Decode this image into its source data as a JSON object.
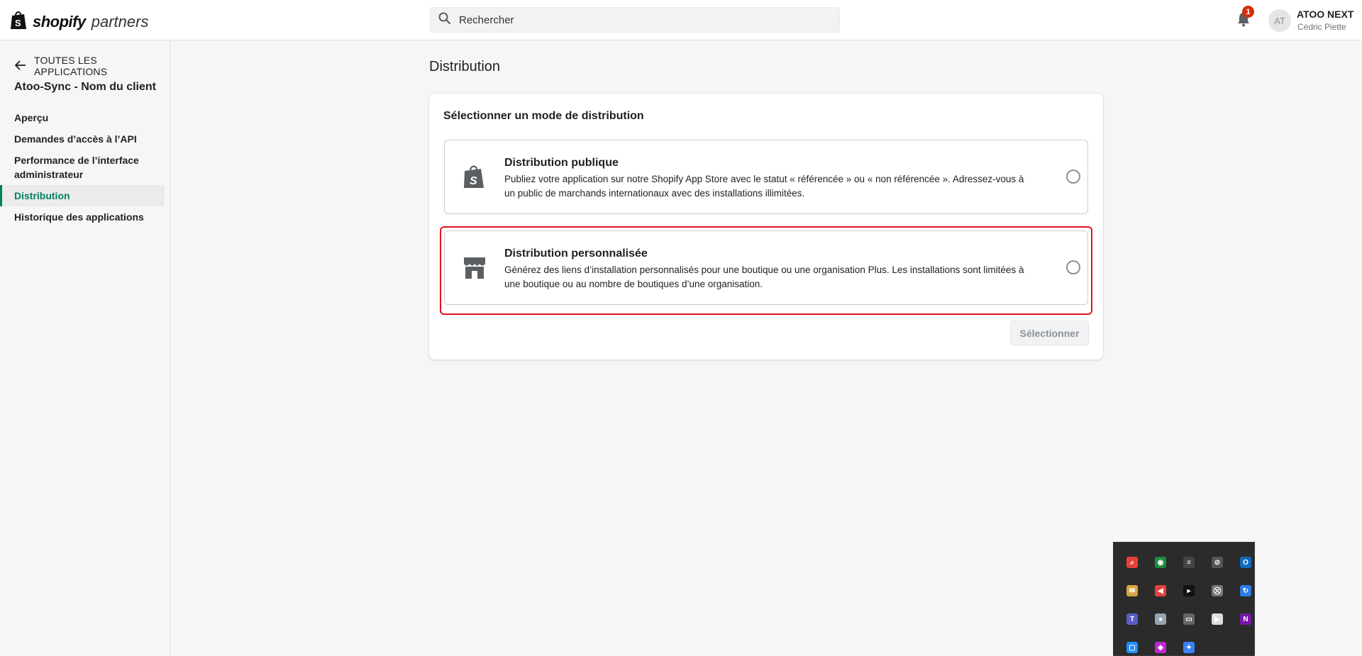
{
  "header": {
    "logo_brand": "shopify",
    "logo_suffix": "partners",
    "search_placeholder": "Rechercher",
    "notification_count": "1",
    "avatar_initials": "AT",
    "account_name": "ATOO NEXT",
    "account_user": "Cédric Piette"
  },
  "sidebar": {
    "back_label": "TOUTES LES APPLICATIONS",
    "app_name": "Atoo-Sync - Nom du client",
    "items": [
      {
        "label": "Aperçu",
        "active": false
      },
      {
        "label": "Demandes d’accès à l’API",
        "active": false
      },
      {
        "label": "Performance de l’interface administrateur",
        "active": false
      },
      {
        "label": "Distribution",
        "active": true
      },
      {
        "label": "Historique des applications",
        "active": false
      }
    ]
  },
  "main": {
    "page_title": "Distribution",
    "card_title": "Sélectionner un mode de distribution",
    "options": [
      {
        "icon": "shopping-bag-icon",
        "title": "Distribution publique",
        "description": "Publiez votre application sur notre Shopify App Store avec le statut « référencée » ou « non référencée ». Adressez-vous à un public de marchands internationaux avec des installations illimitées.",
        "selected": false
      },
      {
        "icon": "store-icon",
        "title": "Distribution personnalisée",
        "description": "Générez des liens d’installation personnalisés pour une boutique ou une organisation Plus. Les installations sont limitées à une boutique ou au nombre de boutiques d’une organisation.",
        "selected": false
      }
    ],
    "select_button": "Sélectionner"
  },
  "tray": {
    "icons": [
      {
        "name": "search-app-icon",
        "color": "#e34234",
        "glyph": "⌕"
      },
      {
        "name": "shield-icon",
        "color": "#1c8c3c",
        "glyph": "◉"
      },
      {
        "name": "list-app-icon",
        "color": "#444444",
        "glyph": "≡"
      },
      {
        "name": "eye-off-icon",
        "color": "#555555",
        "glyph": "⊘"
      },
      {
        "name": "outlook-icon",
        "color": "#0f6cbd",
        "glyph": "O"
      },
      {
        "name": "mail-icon",
        "color": "#d9a441",
        "glyph": "✉"
      },
      {
        "name": "audio-app-icon",
        "color": "#e4403f",
        "glyph": "◀"
      },
      {
        "name": "terminal-app-icon",
        "color": "#111111",
        "glyph": "▸"
      },
      {
        "name": "network-icon",
        "color": "#777777",
        "glyph": "⛒"
      },
      {
        "name": "sync-icon",
        "color": "#2c7be5",
        "glyph": "↻"
      },
      {
        "name": "teams-icon",
        "color": "#5b5fc7",
        "glyph": "T"
      },
      {
        "name": "steam-icon",
        "color": "#9aa4ad",
        "glyph": "●"
      },
      {
        "name": "display-icon",
        "color": "#666666",
        "glyph": "▭"
      },
      {
        "name": "media-play-icon",
        "color": "#dddddd",
        "glyph": "▶"
      },
      {
        "name": "onenote-icon",
        "color": "#7719aa",
        "glyph": "N"
      },
      {
        "name": "window-app-icon",
        "color": "#1e90ff",
        "glyph": "▢"
      },
      {
        "name": "diamond-app-icon",
        "color": "#c026d3",
        "glyph": "◆"
      },
      {
        "name": "copilot-icon",
        "color": "#3b82f6",
        "glyph": "✦"
      }
    ]
  }
}
